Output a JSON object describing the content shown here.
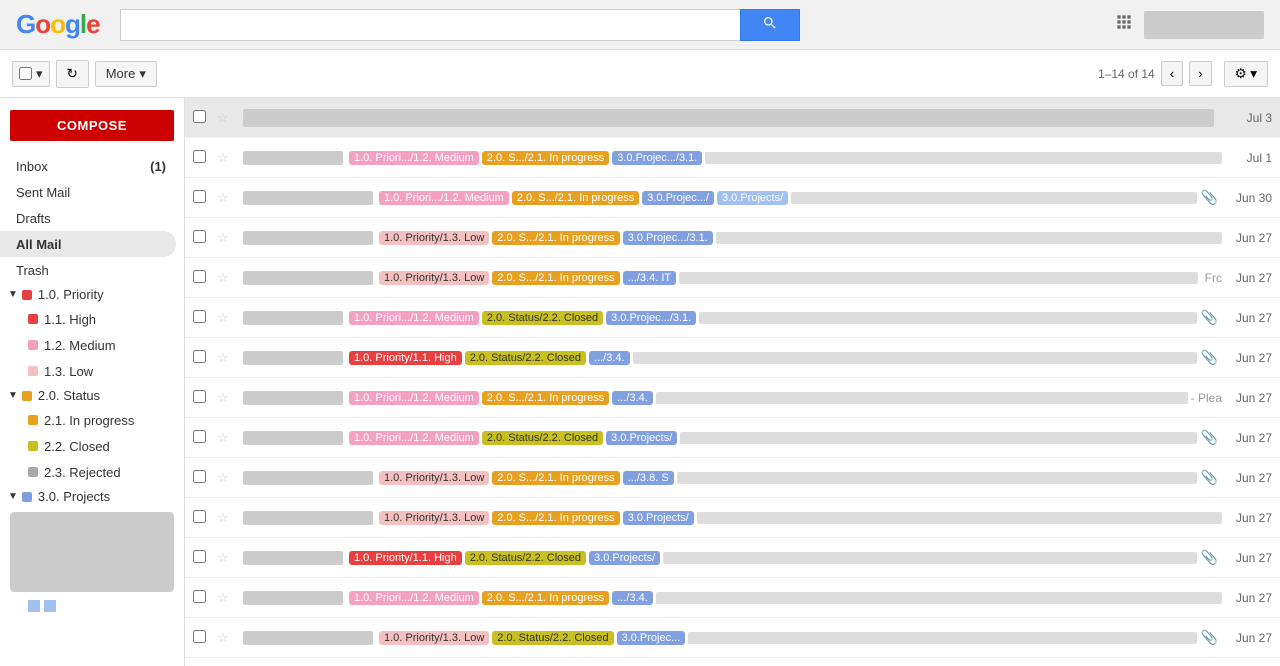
{
  "header": {
    "logo_letters": [
      "G",
      "o",
      "o",
      "g",
      "l",
      "e"
    ],
    "search_placeholder": "",
    "search_button_icon": "🔍",
    "grid_icon": "⊞",
    "user_box": ""
  },
  "toolbar": {
    "select_all_label": "",
    "refresh_icon": "↻",
    "more_label": "More",
    "more_arrow": "▾",
    "pagination": "1–14 of 14",
    "prev_icon": "‹",
    "next_icon": "›",
    "settings_icon": "⚙",
    "settings_arrow": "▾"
  },
  "sidebar": {
    "compose": "COMPOSE",
    "items": [
      {
        "label": "Inbox",
        "count": "(1)",
        "id": "inbox"
      },
      {
        "label": "Sent Mail",
        "count": "",
        "id": "sent"
      },
      {
        "label": "Drafts",
        "count": "",
        "id": "drafts"
      },
      {
        "label": "All Mail",
        "count": "",
        "id": "allmail",
        "active": true
      },
      {
        "label": "Trash",
        "count": "",
        "id": "trash"
      }
    ],
    "sections": [
      {
        "label": "1.0. Priority",
        "color": "#e84040",
        "children": [
          {
            "label": "1.1. High",
            "color": "#e84040"
          },
          {
            "label": "1.2. Medium",
            "color": "#f4a0c0"
          },
          {
            "label": "1.3. Low",
            "color": "#f4c0c0"
          }
        ]
      },
      {
        "label": "2.0. Status",
        "color": "#e8a020",
        "children": [
          {
            "label": "2.1. In progress",
            "color": "#e8a020"
          },
          {
            "label": "2.2. Closed",
            "color": "#c8c020"
          },
          {
            "label": "2.3. Rejected",
            "color": "#aaaaaa"
          }
        ]
      },
      {
        "label": "3.0. Projects",
        "color": "#80a0e0",
        "children": []
      }
    ]
  },
  "emails": [
    {
      "id": 1,
      "sender_width": 140,
      "tags": [],
      "snippet_width": 400,
      "date": "Jul 3",
      "attach": false,
      "header": true
    },
    {
      "id": 2,
      "sender_width": 100,
      "tags": [
        "1.0. Priori.../1.2. Medium",
        "2.0. S.../2.1. In progress",
        "3.0.Projec.../3.1."
      ],
      "snippet_width": 320,
      "date": "Jul 1",
      "attach": false
    },
    {
      "id": 3,
      "sender_width": 130,
      "tags": [
        "1.0. Priori.../1.2. Medium",
        "2.0. S.../2.1. In progress",
        "3.0.Projec.../",
        "3.0.Projects/"
      ],
      "snippet_width": 200,
      "date": "Jun 30",
      "attach": true
    },
    {
      "id": 4,
      "sender_width": 130,
      "tags": [
        "1.0. Priority/1.3. Low",
        "2.0. S.../2.1. In progress",
        "3.0.Projec.../3.1."
      ],
      "snippet_width": 240,
      "date": "Jun 27",
      "attach": false
    },
    {
      "id": 5,
      "sender_width": 130,
      "tags": [
        "1.0. Priority/1.3. Low",
        "2.0. S.../2.1. In progress",
        ".../3.4. IT"
      ],
      "snippet_width": 240,
      "date": "Jun 27",
      "attach": false,
      "extra": "Frc"
    },
    {
      "id": 6,
      "sender_width": 100,
      "tags": [
        "1.0. Priori.../1.2. Medium",
        "2.0. Status/2.2. Closed",
        "3.0.Projec.../3.1."
      ],
      "snippet_width": 320,
      "date": "Jun 27",
      "attach": true
    },
    {
      "id": 7,
      "sender_width": 100,
      "tags": [
        "1.0. Priority/1.1. High",
        "2.0. Status/2.2. Closed",
        ".../3.4."
      ],
      "snippet_width": 340,
      "date": "Jun 27",
      "attach": true,
      "tag_high": true
    },
    {
      "id": 8,
      "sender_width": 100,
      "tags": [
        "1.0. Priori.../1.2. Medium",
        "2.0. S.../2.1. In progress",
        ".../3.4."
      ],
      "snippet_width": 300,
      "date": "Jun 27",
      "attach": false,
      "extra2": "- Plea"
    },
    {
      "id": 9,
      "sender_width": 100,
      "tags": [
        "1.0. Priori.../1.2. Medium",
        "2.0. Status/2.2. Closed",
        "3.0.Projects/"
      ],
      "snippet_width": 340,
      "date": "Jun 27",
      "attach": true
    },
    {
      "id": 10,
      "sender_width": 130,
      "tags": [
        "1.0. Priority/1.3. Low",
        "2.0. S.../2.1. In progress",
        ".../3.8. S"
      ],
      "snippet_width": 340,
      "date": "Jun 27",
      "attach": true
    },
    {
      "id": 11,
      "sender_width": 130,
      "tags": [
        "1.0. Priority/1.3. Low",
        "2.0. S.../2.1. In progress",
        "3.0.Projects/"
      ],
      "snippet_width": 340,
      "date": "Jun 27",
      "attach": false
    },
    {
      "id": 12,
      "sender_width": 100,
      "tags": [
        "1.0. Priority/1.1. High",
        "2.0. Status/2.2. Closed",
        "3.0.Projects/"
      ],
      "snippet_width": 340,
      "date": "Jun 27",
      "attach": true,
      "tag_high": true
    },
    {
      "id": 13,
      "sender_width": 100,
      "tags": [
        "1.0. Priori.../1.2. Medium",
        "2.0. S.../2.1. In progress",
        ".../3.4."
      ],
      "snippet_width": 340,
      "date": "Jun 27",
      "attach": false
    },
    {
      "id": 14,
      "sender_width": 130,
      "tags": [
        "1.0. Priority/1.3. Low",
        "2.0. Status/2.2. Closed",
        "3.0.Projec..."
      ],
      "snippet_width": 260,
      "date": "Jun 27",
      "attach": true
    }
  ]
}
